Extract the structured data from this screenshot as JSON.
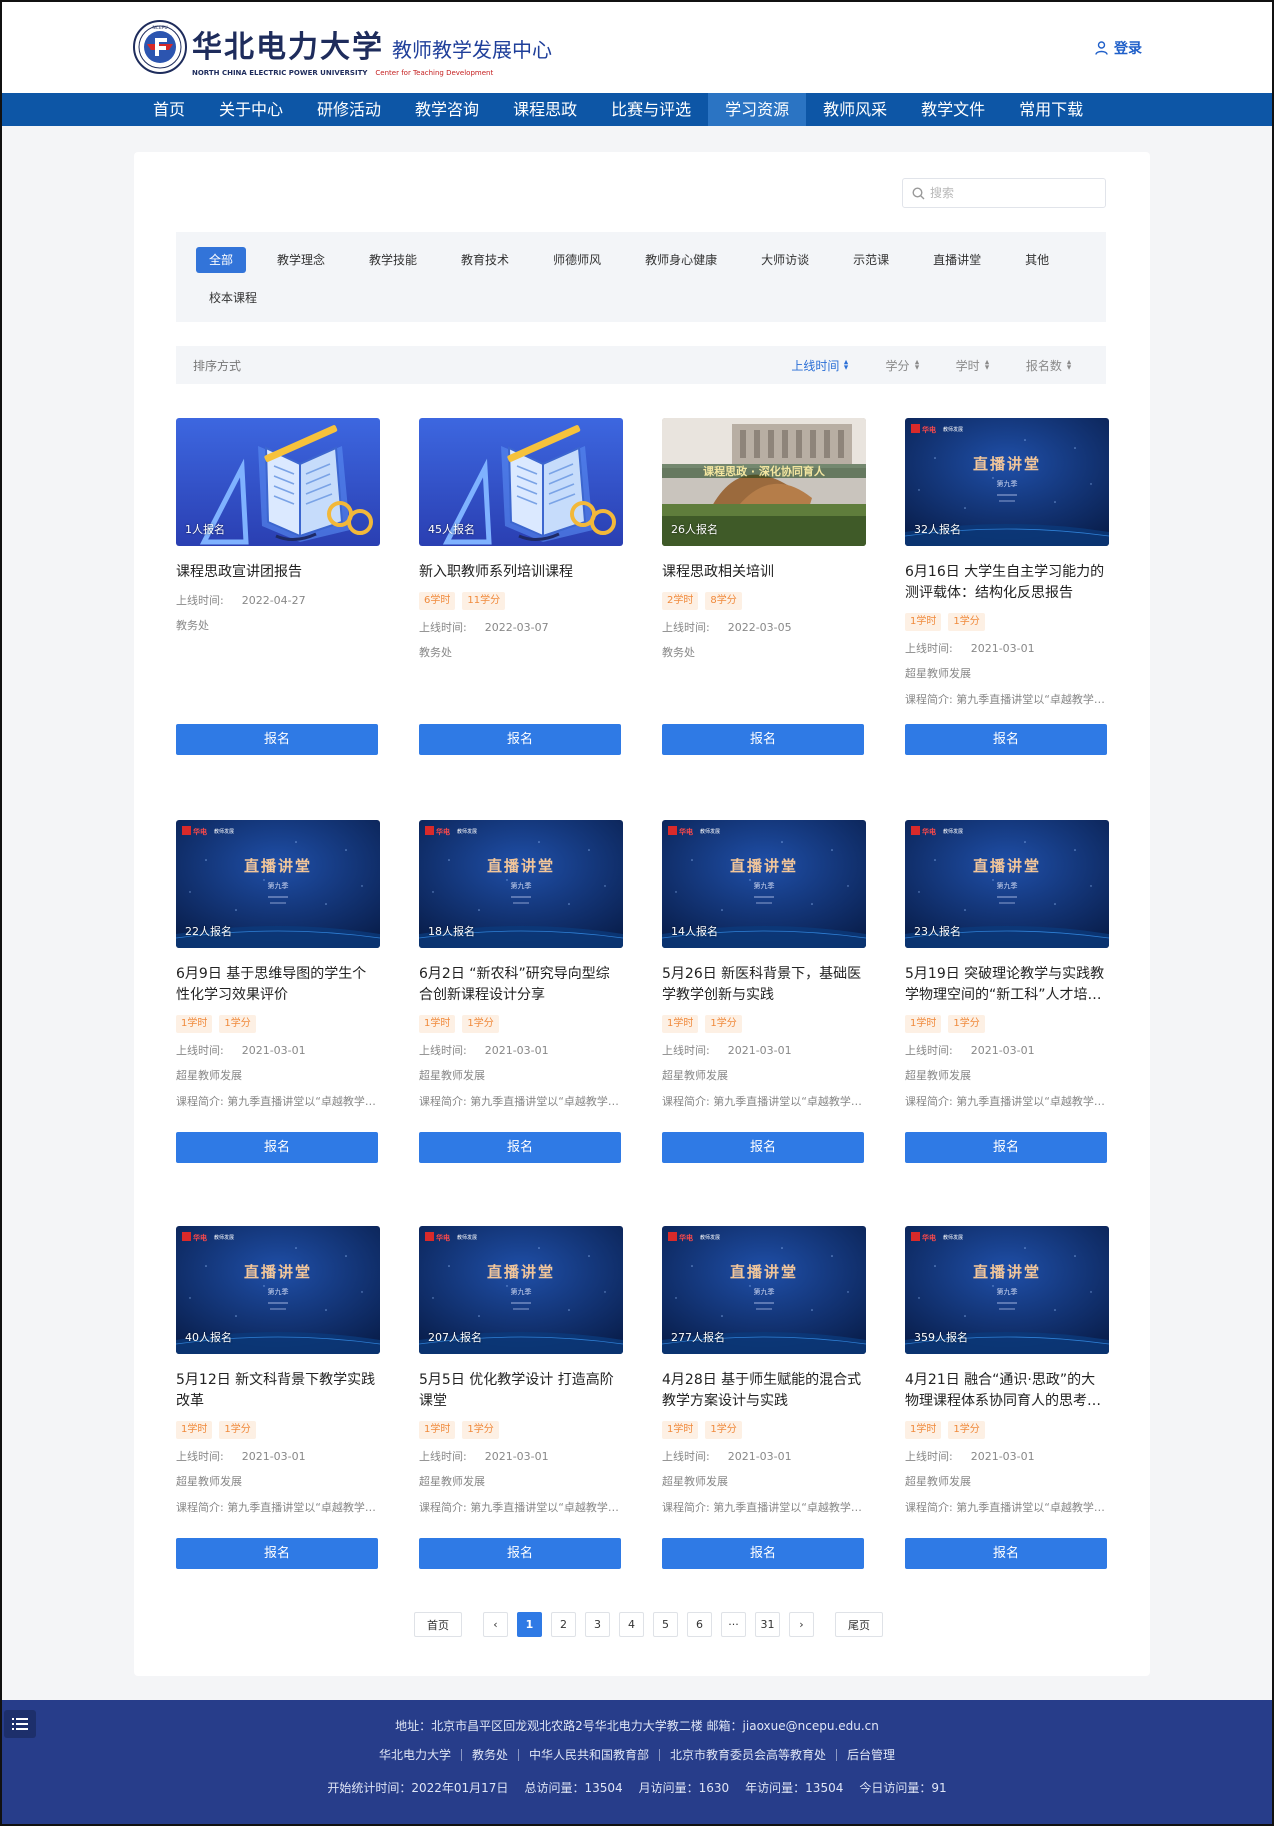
{
  "header": {
    "brand_cn": "华北电力大学",
    "brand_center": "教师教学发展中心",
    "brand_en": "NORTH CHINA ELECTRIC POWER UNIVERSITY",
    "brand_en_sub": "Center for Teaching Development",
    "login_label": "登录",
    "logo_letters": "NCEPU"
  },
  "nav": {
    "items": [
      "首页",
      "关于中心",
      "研修活动",
      "教学咨询",
      "课程思政",
      "比赛与评选",
      "学习资源",
      "教师风采",
      "教学文件",
      "常用下载"
    ],
    "active_index": 6
  },
  "search": {
    "placeholder": "搜索"
  },
  "categories": {
    "items": [
      "全部",
      "教学理念",
      "教学技能",
      "教育技术",
      "师德师风",
      "教师身心健康",
      "大师访谈",
      "示范课",
      "直播讲堂",
      "其他",
      "校本课程"
    ],
    "active_index": 0
  },
  "sort": {
    "label": "排序方式",
    "options": [
      "上线时间",
      "学分",
      "学时",
      "报名数"
    ],
    "active_index": 0
  },
  "cards": [
    {
      "enrolled": "1人报名",
      "title": "课程思政宣讲团报告",
      "hours": "",
      "credits": "",
      "online_label": "上线时间:",
      "date": "2022-04-27",
      "org": "教务处",
      "intro": "",
      "button": "报名",
      "thumb": "book"
    },
    {
      "enrolled": "45人报名",
      "title": "新入职教师系列培训课程",
      "hours": "6学时",
      "credits": "11学分",
      "online_label": "上线时间:",
      "date": "2022-03-07",
      "org": "教务处",
      "intro": "",
      "button": "报名",
      "thumb": "book"
    },
    {
      "enrolled": "26人报名",
      "title": "课程思政相关培训",
      "hours": "2学时",
      "credits": "8学分",
      "online_label": "上线时间:",
      "date": "2022-03-05",
      "org": "教务处",
      "intro": "",
      "button": "报名",
      "thumb": "campus"
    },
    {
      "enrolled": "32人报名",
      "title": "6月16日 大学生自主学习能力的测评载体：结构化反思报告",
      "hours": "1学时",
      "credits": "1学分",
      "online_label": "上线时间:",
      "date": "2021-03-01",
      "org": "超星教师发展",
      "intro": "课程简介: 第九季直播讲堂以“卓越教学…",
      "button": "报名",
      "thumb": "live"
    },
    {
      "enrolled": "22人报名",
      "title": "6月9日 基于思维导图的学生个性化学习效果评价",
      "hours": "1学时",
      "credits": "1学分",
      "online_label": "上线时间:",
      "date": "2021-03-01",
      "org": "超星教师发展",
      "intro": "课程简介: 第九季直播讲堂以“卓越教学…",
      "button": "报名",
      "thumb": "live"
    },
    {
      "enrolled": "18人报名",
      "title": "6月2日 “新农科”研究导向型综合创新课程设计分享",
      "hours": "1学时",
      "credits": "1学分",
      "online_label": "上线时间:",
      "date": "2021-03-01",
      "org": "超星教师发展",
      "intro": "课程简介: 第九季直播讲堂以“卓越教学…",
      "button": "报名",
      "thumb": "live"
    },
    {
      "enrolled": "14人报名",
      "title": "5月26日 新医科背景下，基础医学教学创新与实践",
      "hours": "1学时",
      "credits": "1学分",
      "online_label": "上线时间:",
      "date": "2021-03-01",
      "org": "超星教师发展",
      "intro": "课程简介: 第九季直播讲堂以“卓越教学…",
      "button": "报名",
      "thumb": "live"
    },
    {
      "enrolled": "23人报名",
      "title": "5月19日 突破理论教学与实践教学物理空间的“新工科”人才培…",
      "hours": "1学时",
      "credits": "1学分",
      "online_label": "上线时间:",
      "date": "2021-03-01",
      "org": "超星教师发展",
      "intro": "课程简介: 第九季直播讲堂以“卓越教学…",
      "button": "报名",
      "thumb": "live"
    },
    {
      "enrolled": "40人报名",
      "title": "5月12日 新文科背景下教学实践改革",
      "hours": "1学时",
      "credits": "1学分",
      "online_label": "上线时间:",
      "date": "2021-03-01",
      "org": "超星教师发展",
      "intro": "课程简介: 第九季直播讲堂以“卓越教学…",
      "button": "报名",
      "thumb": "live"
    },
    {
      "enrolled": "207人报名",
      "title": "5月5日 优化教学设计 打造高阶课堂",
      "hours": "1学时",
      "credits": "1学分",
      "online_label": "上线时间:",
      "date": "2021-03-01",
      "org": "超星教师发展",
      "intro": "课程简介: 第九季直播讲堂以“卓越教学…",
      "button": "报名",
      "thumb": "live"
    },
    {
      "enrolled": "277人报名",
      "title": "4月28日 基于师生赋能的混合式教学方案设计与实践",
      "hours": "1学时",
      "credits": "1学分",
      "online_label": "上线时间:",
      "date": "2021-03-01",
      "org": "超星教师发展",
      "intro": "课程简介: 第九季直播讲堂以“卓越教学…",
      "button": "报名",
      "thumb": "live"
    },
    {
      "enrolled": "359人报名",
      "title": "4月21日 融合“通识·思政”的大物理课程体系协同育人的思考与…",
      "hours": "1学时",
      "credits": "1学分",
      "online_label": "上线时间:",
      "date": "2021-03-01",
      "org": "超星教师发展",
      "intro": "课程简介: 第九季直播讲堂以“卓越教学…",
      "button": "报名",
      "thumb": "live"
    }
  ],
  "thumb_text": {
    "live_title": "直播讲堂",
    "live_season": "第九季",
    "live_brand": "教师发展",
    "campus_banner": "课程思政 · 深化协同育人"
  },
  "pagination": {
    "first": "首页",
    "prev": "‹",
    "pages": [
      "1",
      "2",
      "3",
      "4",
      "5",
      "6"
    ],
    "ellipsis": "···",
    "last_page": "31",
    "next": "›",
    "last": "尾页",
    "current": "1"
  },
  "footer": {
    "address": "地址：北京市昌平区回龙观北农路2号华北电力大学教二楼    邮箱：jiaoxue@ncepu.edu.cn",
    "links": [
      "华北电力大学",
      "教务处",
      "中华人民共和国教育部",
      "北京市教育委员会高等教育处",
      "后台管理"
    ],
    "stats": [
      "开始统计时间：2022年01月17日",
      "总访问量：13504",
      "月访问量：1630",
      "年访问量：13504",
      "今日访问量：91"
    ]
  },
  "colors": {
    "nav": "#0d56a6",
    "nav_active": "#2b74c3",
    "primary": "#2f7ae5",
    "footer": "#273d8a",
    "tag_text": "#f08a3c",
    "tag_bg": "#fdf0e4"
  }
}
